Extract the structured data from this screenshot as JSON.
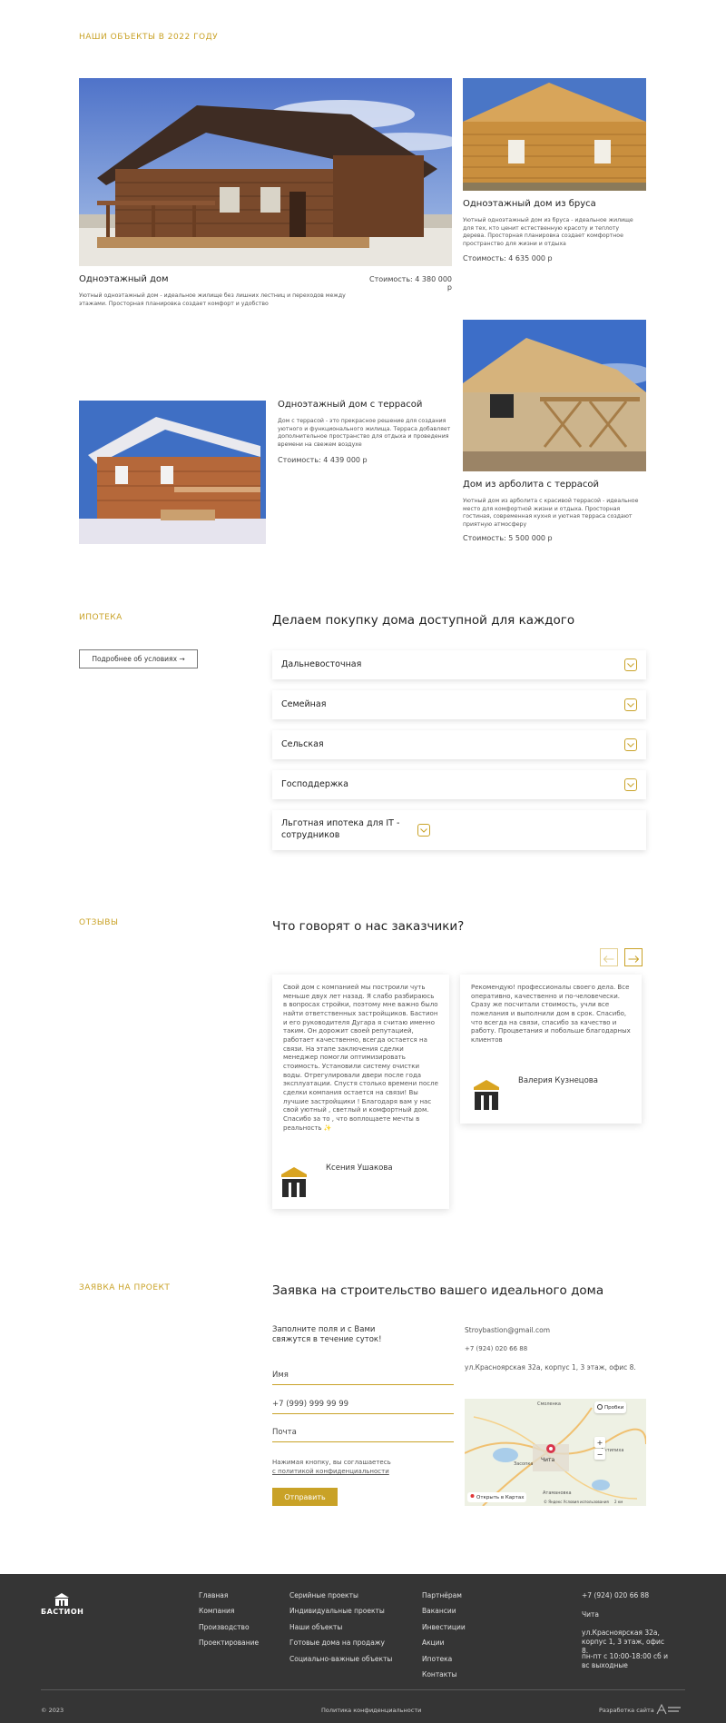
{
  "objects": {
    "label": "НАШИ ОБЪЕКТЫ В 2022 ГОДУ",
    "cards": [
      {
        "title": "Одноэтажный дом",
        "price": "Стоимость: 4 380 000 р",
        "desc": "Уютный одноэтажный дом - идеальное жилище без лишних лестниц и переходов между этажами. Просторная планировка создает комфорт и удобство"
      },
      {
        "title": "Одноэтажный дом из бруса",
        "price": "Стоимость: 4 635 000 р",
        "desc": "Уютный одноэтажный дом из бруса - идеальное жилище для тех, кто ценит естественную красоту и теплоту дерева. Просторная планировка создает комфортное пространство для жизни и отдыха"
      },
      {
        "title": "Одноэтажный дом с террасой",
        "price": "Стоимость: 4 439 000 р",
        "desc": "Дом с террасой - это прекрасное решение для создания уютного и функционального жилища. Терраса добавляет дополнительное пространство для отдыха и проведения времени на свежем воздухе"
      },
      {
        "title": "Дом из арболита с террасой",
        "price": "Стоимость: 5 500 000 р",
        "desc": "Уютный дом из арболита с красивой террасой - идеальное место для комфортной жизни и отдыха. Просторная гостиная, современная кухня и уютная терраса создают приятную атмосферу"
      }
    ]
  },
  "mortgage": {
    "label": "ИПОТЕКА",
    "button": "Подробнее об условиях →",
    "heading": "Делаем покупку дома доступной для каждого",
    "items": [
      "Дальневосточная",
      "Семейная",
      "Сельская",
      "Господдержка",
      "Льготная ипотека для IT - сотрудников"
    ]
  },
  "reviews": {
    "label": "ОТЗЫВЫ",
    "heading": "Что говорят о нас заказчики?",
    "items": [
      {
        "text": "Свой дом с компанией мы построили чуть меньше двух лет назад. Я слабо разбираюсь в вопросах стройки, поэтому мне важно было найти ответственных застройщиков. Бастион и его руководителя Дугара я считаю именно таким. Он дорожит своей репутацией, работает качественно, всегда остается на связи. На этапе заключения сделки менеджер помогли оптимизировать стоимость. Установили систему очистки воды. Отрегулировали двери после года эксплуатации. Спустя столько времени после сделки компания остается на связи! Вы лучшие застройщики ! Благодаря вам у нас свой уютный , светлый и комфортный дом. Спасибо за то , что воплощаете мечты в реальность ✨",
        "name": "Ксения Ушакова"
      },
      {
        "text": "Рекомендую! профессионалы своего дела. Все оперативно, качественно и по-человечески. Сразу же посчитали стоимость, учли все пожелания и выполнили дом в срок. Спасибо, что всегда на связи, спасибо за качество и работу. Процветания и побольше благодарных клиентов",
        "name": "Валерия Кузнецова"
      }
    ]
  },
  "request": {
    "label": "ЗАЯВКА НА ПРОЕКТ",
    "heading": "Заявка на строительство вашего идеального дома",
    "lead": "Заполните поля и с Вами свяжутся в течение суток!",
    "fields": {
      "name": "Имя",
      "phone": "+7 (999) 999 99 99",
      "mail": "Почта"
    },
    "consent": "Нажимая кнопку, вы соглашаетесь",
    "consent_link": "с политикой конфиденциальности",
    "submit": "Отправить",
    "email": "Stroybastion@gmail.com",
    "phone": "+7 (924) 020 66 88",
    "address": "ул.Красноярская 32а, корпус 1, 3 этаж, офис 8.",
    "map": {
      "open_in_maps": "Открыть в Картах",
      "traffic": "Пробки",
      "city": "Чита",
      "places": [
        "Смоленка",
        "Засопка",
        "Атамановка",
        "Антипиха"
      ],
      "credits": "© Яндекс Условия использования",
      "scale": "2 км"
    }
  },
  "footer": {
    "brand": "БАСТИОН",
    "col1": [
      "Главная",
      "Компания",
      "Производство",
      "Проектирование"
    ],
    "col2": [
      "Серийные проекты",
      "Индивидуальные проекты",
      "Наши объекты",
      "Готовые дома на продажу",
      "Социально-важные объекты"
    ],
    "col3": [
      "Партнёрам",
      "Вакансии",
      "Инвестиции",
      "Акции",
      "Ипотека",
      "Контакты"
    ],
    "phone": "+7 (924) 020 66 88",
    "city": "Чита",
    "address": "ул.Красноярская 32а, корпус 1, 3 этаж, офис 8.",
    "hours": "пн-пт с 10:00-18:00 сб и вс выходные",
    "copyright": "© 2023",
    "privacy": "Политика конфиденциальности",
    "dev": "Разработка сайта"
  }
}
